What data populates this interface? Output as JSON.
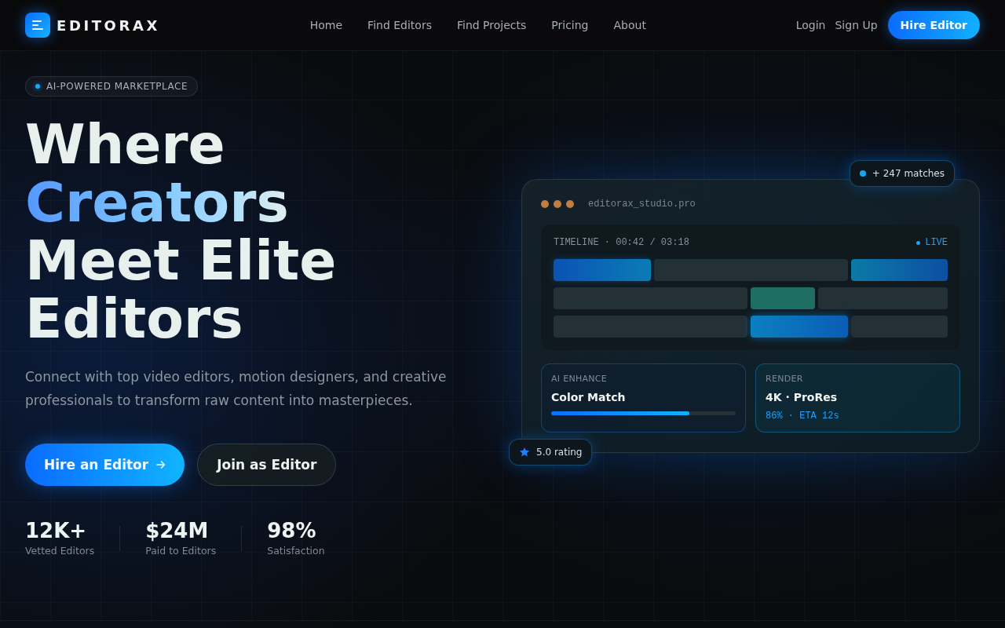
{
  "header": {
    "brand": "EDITORAX",
    "nav": [
      {
        "label": "Home"
      },
      {
        "label": "Find Editors"
      },
      {
        "label": "Find Projects"
      },
      {
        "label": "Pricing"
      },
      {
        "label": "About"
      }
    ],
    "login": "Login",
    "signup": "Sign Up",
    "cta": "Hire Editor"
  },
  "hero": {
    "badge": "AI-POWERED MARKETPLACE",
    "heading": [
      {
        "text": "Where",
        "accent": false
      },
      {
        "text": "Creators",
        "accent": true
      },
      {
        "text": "Meet Elite",
        "accent": false
      },
      {
        "text": "Editors",
        "accent": false
      }
    ],
    "description": "Connect with top video editors, motion designers, and creative professionals to transform raw content into masterpieces.",
    "buttons": [
      {
        "label": "Hire an Editor",
        "kind": "primary"
      },
      {
        "label": "Join as Editor",
        "kind": "secondary"
      }
    ],
    "stats": [
      {
        "value": "12K+",
        "label": "Vetted Editors"
      },
      {
        "value": "$24M",
        "label": "Paid to Editors"
      },
      {
        "value": "98%",
        "label": "Satisfaction"
      }
    ]
  },
  "preview": {
    "matches": "+ 247 matches",
    "title": "editorax_studio.pro",
    "timeline": {
      "label": "TIMELINE · 00:42 / 03:18",
      "status": "LIVE",
      "tracks": [
        {
          "clips": [
            {
              "kind": "primary"
            },
            {
              "kind": "plain"
            },
            {
              "kind": "secondary"
            }
          ]
        },
        {
          "clips": [
            {
              "kind": "plain"
            },
            {
              "kind": "teal"
            },
            {
              "kind": "plain"
            }
          ]
        },
        {
          "clips": [
            {
              "kind": "plain"
            },
            {
              "kind": "highlight"
            },
            {
              "kind": "plain"
            }
          ]
        }
      ]
    },
    "cards": [
      {
        "kind": "progress",
        "label": "AI ENHANCE",
        "title": "Color Match",
        "level": 0.75
      },
      {
        "kind": "status",
        "label": "RENDER",
        "title": "4K · ProRes",
        "status": "86% · ETA 12s"
      }
    ],
    "rating": "5.0 rating"
  }
}
